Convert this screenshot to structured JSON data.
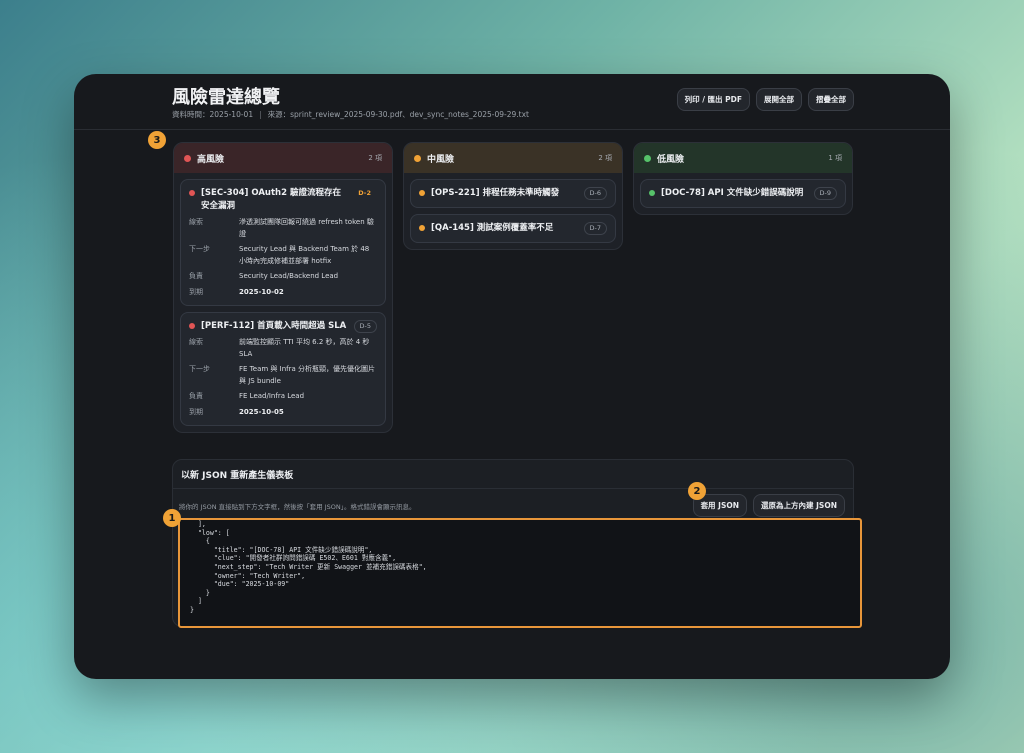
{
  "header": {
    "title": "風險雷達總覽",
    "data_time": "資料時間：2025-10-01",
    "separator": "|",
    "source": "來源：sprint_review_2025-09-30.pdf、dev_sync_notes_2025-09-29.txt",
    "buttons": {
      "print": "列印 / 匯出 PDF",
      "expand": "展開全部",
      "collapse": "摺疊全部"
    }
  },
  "markers": {
    "one": "1",
    "two": "2",
    "three": "3"
  },
  "colors": {
    "high": "#e05555",
    "mid": "#f0a236",
    "low": "#56c26a",
    "accent": "#e8963a"
  },
  "labels": {
    "clue": "線索",
    "next_step": "下一步",
    "owner": "負責",
    "due": "到期"
  },
  "columns": {
    "high": {
      "name": "高風險",
      "count": "2 項",
      "items": [
        {
          "title": "[SEC-304] OAuth2 驗證流程存在安全漏洞",
          "tag": "D-2",
          "clue": "滲透測試團隊回報可繞過 refresh token 驗證",
          "next_step": "Security Lead 與 Backend Team 於 48 小時內完成修補並部署 hotfix",
          "owner": "Security Lead/Backend Lead",
          "due": "2025-10-02"
        },
        {
          "title": "[PERF-112] 首頁載入時間超過 SLA",
          "tag": "D-5",
          "clue": "前端監控顯示 TTI 平均 6.2 秒，高於 4 秒 SLA",
          "next_step": "FE Team 與 Infra 分析瓶頸，優先優化圖片與 JS bundle",
          "owner": "FE Lead/Infra Lead",
          "due": "2025-10-05"
        }
      ]
    },
    "mid": {
      "name": "中風險",
      "count": "2 項",
      "items": [
        {
          "title": "[OPS-221] 排程任務未準時觸發",
          "tag": "D-6"
        },
        {
          "title": "[QA-145] 測試案例覆蓋率不足",
          "tag": "D-7"
        }
      ]
    },
    "low": {
      "name": "低風險",
      "count": "1 項",
      "items": [
        {
          "title": "[DOC-78] API 文件缺少錯誤碼說明",
          "tag": "D-9"
        }
      ]
    }
  },
  "json_panel": {
    "title": "以新 JSON 重新產生儀表板",
    "hint": "將你的 JSON 直接貼到下方文字框，然後按「套用 JSON」。格式錯誤會顯示訊息。",
    "apply_button": "套用 JSON",
    "restore_button": "還原為上方內建 JSON",
    "textarea_value": "  ],\n  \"low\": [\n    {\n      \"title\": \"[DOC-78] API 文件缺少錯誤碼說明\",\n      \"clue\": \"開發者社群詢問錯誤碼 E502、E601 對應含義\",\n      \"next_step\": \"Tech Writer 更新 Swagger 並補充錯誤碼表格\",\n      \"owner\": \"Tech Writer\",\n      \"due\": \"2025-10-09\"\n    }\n  ]\n}"
  }
}
